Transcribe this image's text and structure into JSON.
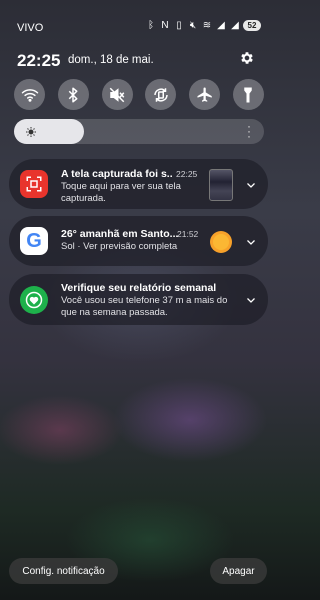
{
  "status_bar": {
    "carrier": "VIVO",
    "icons": [
      "bluetooth-icon",
      "nfc-icon",
      "vibrate-icon",
      "mute-icon",
      "wifi-icon",
      "signal-icon",
      "signal-icon"
    ],
    "battery": "52"
  },
  "header": {
    "time": "22:25",
    "date": "dom., 18 de mai."
  },
  "quick_toggles": [
    {
      "name": "wifi-toggle",
      "icon": "wifi-icon"
    },
    {
      "name": "bluetooth-toggle",
      "icon": "bluetooth-icon"
    },
    {
      "name": "sound-toggle",
      "icon": "mute-icon"
    },
    {
      "name": "auto-rotate-toggle",
      "icon": "rotate-icon"
    },
    {
      "name": "airplane-toggle",
      "icon": "airplane-icon"
    },
    {
      "name": "flashlight-toggle",
      "icon": "flashlight-icon"
    }
  ],
  "brightness": {
    "level": 0.28
  },
  "notifications": [
    {
      "app": "screenshot",
      "title": "A tela capturada foi s...",
      "time": "22:25",
      "body": "Toque aqui para ver sua tela capturada.",
      "accent": "#e8342c"
    },
    {
      "app": "google",
      "title": "26° amanhã em Santo...",
      "time": "21:52",
      "body": "Sol · Ver previsão completa",
      "accent": "#ffffff"
    },
    {
      "app": "samsung-health",
      "title": "Verifique seu relatório semanal",
      "time": "",
      "body": "Você usou seu telefone 37 m a mais do que na semana passada.",
      "accent": "#1eb14b"
    }
  ],
  "footer": {
    "settings_label": "Config. notificação",
    "clear_label": "Apagar"
  }
}
